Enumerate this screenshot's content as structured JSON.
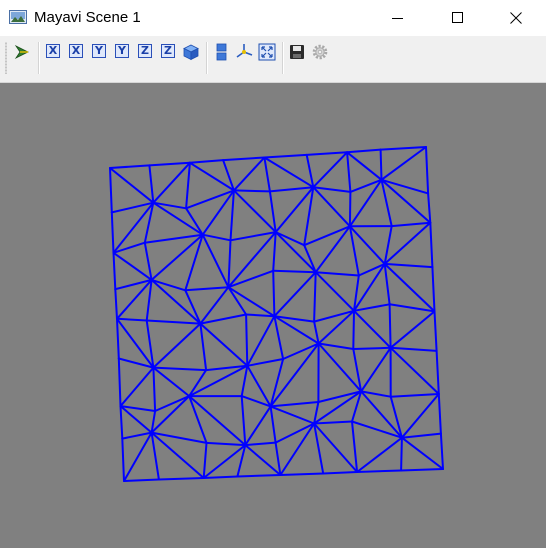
{
  "window": {
    "title": "Mayavi Scene 1",
    "controls": [
      "minimize",
      "maximize",
      "close"
    ]
  },
  "toolbar": {
    "buttons": [
      {
        "name": "pipeline-icon"
      },
      {
        "name": "view-x-plus-button",
        "label": "X"
      },
      {
        "name": "view-x-minus-button",
        "label": "X"
      },
      {
        "name": "view-y-plus-button",
        "label": "Y"
      },
      {
        "name": "view-y-minus-button",
        "label": "Y"
      },
      {
        "name": "view-z-plus-button",
        "label": "Z"
      },
      {
        "name": "view-z-minus-button",
        "label": "Z"
      },
      {
        "name": "isometric-view-icon"
      },
      {
        "name": "parallel-projection-icon"
      },
      {
        "name": "axes-indicator-icon"
      },
      {
        "name": "full-screen-icon"
      },
      {
        "name": "save-icon"
      },
      {
        "name": "settings-icon"
      }
    ]
  },
  "scene": {
    "background_color": "#808080",
    "mesh_color": "#0000ff",
    "mesh_type": "triangulated square wireframe"
  }
}
